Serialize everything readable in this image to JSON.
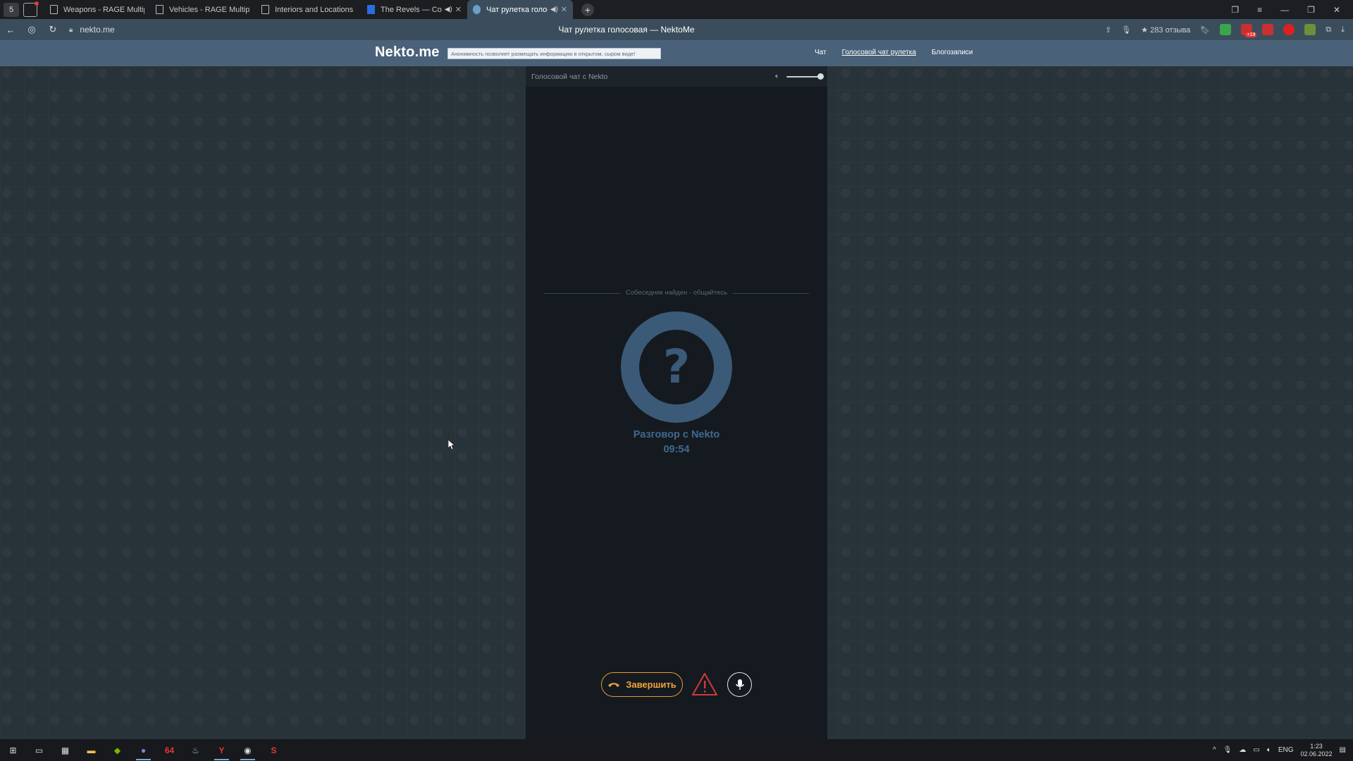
{
  "browser": {
    "tab_count": "5",
    "tabs": [
      {
        "title": "Weapons - RAGE Multiplay",
        "active": false
      },
      {
        "title": "Vehicles - RAGE Multiplaye",
        "active": false
      },
      {
        "title": "Interiors and Locations - R",
        "active": false
      },
      {
        "title": "The Revels — Coman",
        "active": false
      },
      {
        "title": "Чат рулетка голосо",
        "active": true
      }
    ],
    "address": "nekto.me",
    "page_title": "Чат рулетка голосовая — NektoMe",
    "reviews": "283 отзыва"
  },
  "site": {
    "logo": "Nekto.me",
    "anon_notice": "Анонимность позволяет размещать информацию в открытом, сыром виде!",
    "nav": {
      "chat": "Чат",
      "voice_roulette": "Голосовой чат рулетка",
      "blogs": "Блогозаписи"
    }
  },
  "panel": {
    "title": "Голосовой чат с Nekto",
    "found_text": "Собеседник найден - общайтесь",
    "avatar_symbol": "?",
    "conversation_label": "Разговор с Nekto",
    "timer": "09:54",
    "end_button": "Завершить"
  },
  "taskbar": {
    "time": "1:23",
    "date": "02.06.2022",
    "lang": "ENG",
    "app_64": "64"
  },
  "colors": {
    "accent_orange": "#f2a43a",
    "avatar_blue": "#3b5a78",
    "header_blue": "#4a6279",
    "warning_red": "#d23a3a"
  }
}
